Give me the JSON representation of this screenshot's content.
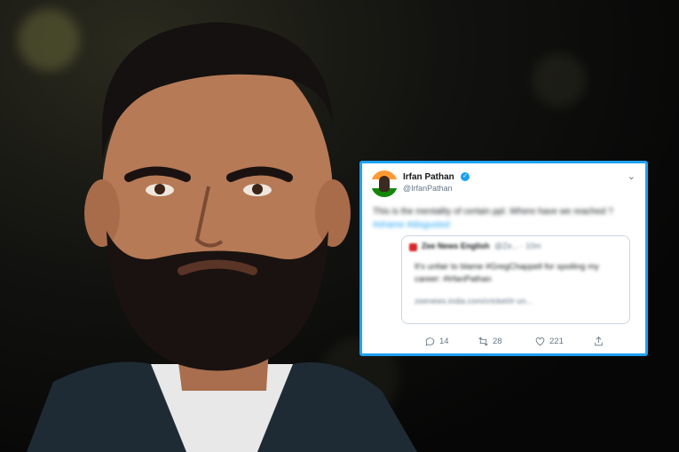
{
  "tweet": {
    "name": "Irfan Pathan",
    "handle": "@IrfanPathan",
    "text": "This is the mentality of certain ppl. Where have we reached ?",
    "hashtags": "#shame #disgusted",
    "quote": {
      "name": "Zee News English",
      "meta": "@Ze... · 10m",
      "text": "It's unfair to blame #GregChappell for spoiling my career: #IrfanPathan",
      "link": "zeenews.india.com/cricket/ir-un..."
    },
    "actions": {
      "replies": "14",
      "retweets": "28",
      "likes": "221"
    }
  },
  "colors": {
    "accent": "#1da1f2",
    "card_border": "#1da1f2"
  },
  "icons": [
    "reply-icon",
    "retweet-icon",
    "like-icon",
    "share-icon",
    "verified-badge-icon",
    "more-options-icon"
  ]
}
